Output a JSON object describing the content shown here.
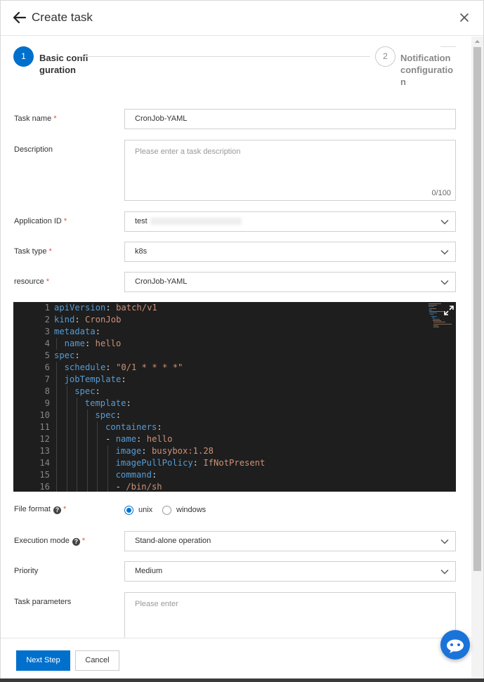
{
  "header": {
    "title": "Create task"
  },
  "steps": [
    {
      "number": "1",
      "label": "Basic configuration"
    },
    {
      "number": "2",
      "label": "Notification configuration"
    }
  ],
  "form": {
    "task_name": {
      "label": "Task name",
      "value": "CronJob-YAML"
    },
    "description": {
      "label": "Description",
      "placeholder": "Please enter a task description",
      "counter": "0/100"
    },
    "application_id": {
      "label": "Application ID",
      "value": "test"
    },
    "task_type": {
      "label": "Task type",
      "value": "k8s"
    },
    "resource": {
      "label": "resource",
      "value": "CronJob-YAML"
    },
    "file_format": {
      "label": "File format",
      "options": [
        "unix",
        "windows"
      ],
      "selected": "unix"
    },
    "execution_mode": {
      "label": "Execution mode",
      "value": "Stand-alone operation"
    },
    "priority": {
      "label": "Priority",
      "value": "Medium"
    },
    "task_parameters": {
      "label": "Task parameters",
      "placeholder": "Please enter"
    }
  },
  "editor": {
    "lines": [
      {
        "n": "1",
        "key": "apiVersion",
        "sep": ": ",
        "val": "batch/v1",
        "indent": 0
      },
      {
        "n": "2",
        "key": "kind",
        "sep": ": ",
        "val": "CronJob",
        "indent": 0
      },
      {
        "n": "3",
        "key": "metadata",
        "sep": ":",
        "val": "",
        "indent": 0
      },
      {
        "n": "4",
        "key": "name",
        "sep": ": ",
        "val": "hello",
        "indent": 1
      },
      {
        "n": "5",
        "key": "spec",
        "sep": ":",
        "val": "",
        "indent": 0
      },
      {
        "n": "6",
        "key": "schedule",
        "sep": ": ",
        "val": "\"0/1 * * * *\"",
        "indent": 1
      },
      {
        "n": "7",
        "key": "jobTemplate",
        "sep": ":",
        "val": "",
        "indent": 1
      },
      {
        "n": "8",
        "key": "spec",
        "sep": ":",
        "val": "",
        "indent": 2
      },
      {
        "n": "9",
        "key": "template",
        "sep": ":",
        "val": "",
        "indent": 3
      },
      {
        "n": "10",
        "key": "spec",
        "sep": ":",
        "val": "",
        "indent": 4
      },
      {
        "n": "11",
        "key": "containers",
        "sep": ":",
        "val": "",
        "indent": 5
      },
      {
        "n": "12",
        "key": "- name",
        "sep": ": ",
        "val": "hello",
        "indent": 5
      },
      {
        "n": "13",
        "key": "image",
        "sep": ": ",
        "val": "busybox:1.28",
        "indent": 6
      },
      {
        "n": "14",
        "key": "imagePullPolicy",
        "sep": ": ",
        "val": "IfNotPresent",
        "indent": 6
      },
      {
        "n": "15",
        "key": "command",
        "sep": ":",
        "val": "",
        "indent": 6
      },
      {
        "n": "16",
        "key": "- ",
        "sep": "",
        "val": "/bin/sh",
        "indent": 6
      }
    ]
  },
  "footer": {
    "next_label": "Next Step",
    "cancel_label": "Cancel"
  },
  "colors": {
    "primary": "#0070cc",
    "required": "#e84c3d",
    "editor_bg": "#1e1e1e",
    "yaml_key": "#569cd6",
    "yaml_value": "#ce9178"
  }
}
